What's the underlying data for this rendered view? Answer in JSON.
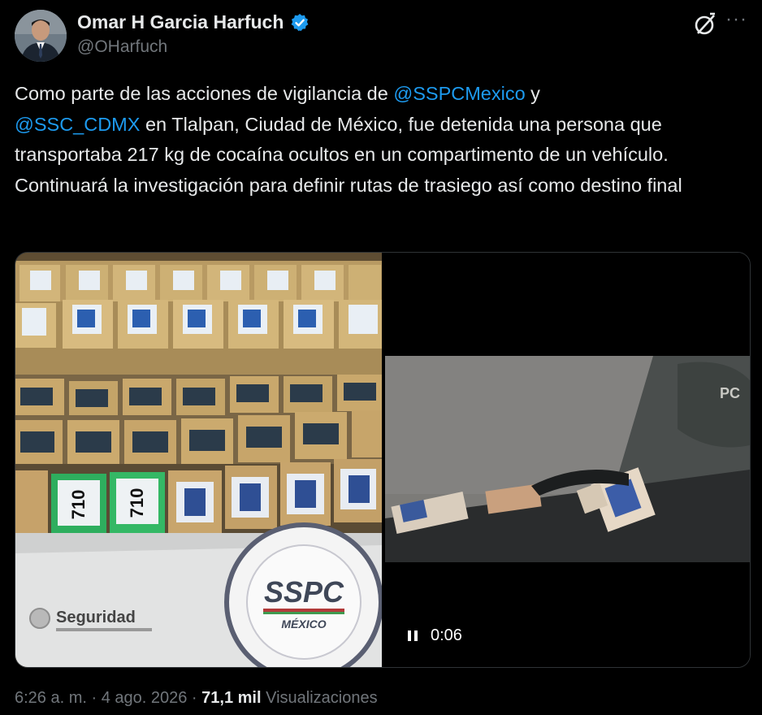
{
  "author": {
    "name": "Omar H Garcia Harfuch",
    "handle": "@OHarfuch",
    "verified_color": "#1d9bf0"
  },
  "tweet": {
    "p1": "Como parte de las acciones de vigilancia de ",
    "m1": "@SSPCMexico",
    "p2": " y ",
    "m2": "@SSC_CDMX",
    "p3": " en Tlalpan, Ciudad de México, fue detenida una persona que transportaba 217 kg de cocaína ocultos en un compartimento de un vehículo. Continuará la investigación para definir rutas de trasiego así como destino final"
  },
  "media": {
    "package_label_1": "710",
    "package_label_2": "710",
    "banner_seal_text": "SSPC",
    "banner_seal_sub": "MÉXICO",
    "banner_seguridad": "Seguridad",
    "video_time": "0:06"
  },
  "meta": {
    "time": "6:26 a. m.",
    "sep1": " · ",
    "date": "4 ago. 2026",
    "sep2": " · ",
    "views_count": "71,1 mil",
    "views_label": " Visualizaciones"
  },
  "icons": [
    "verified-badge-icon",
    "grok-icon",
    "more-icon",
    "pause-icon"
  ]
}
